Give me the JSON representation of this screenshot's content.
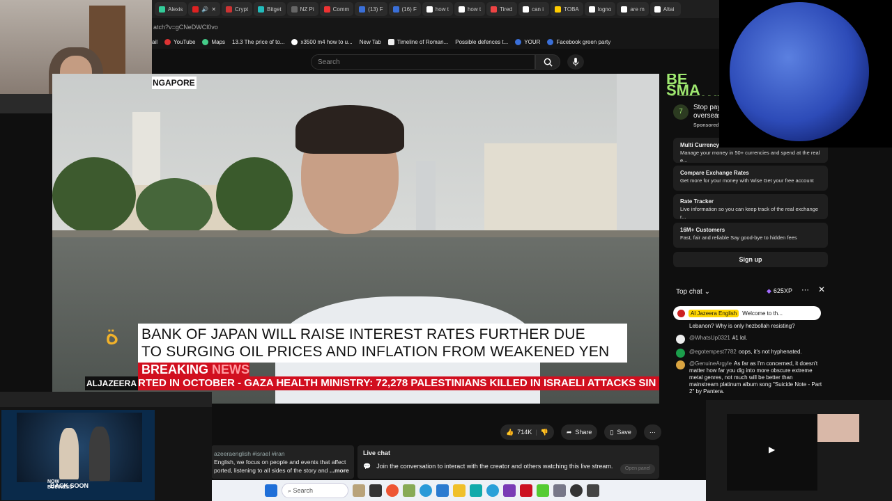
{
  "browser": {
    "tabs": [
      "Alexis",
      "Crypt",
      "Bitget",
      "NZ Pi",
      "Comm",
      "(13) F",
      "(16) F",
      "how t",
      "how t",
      "Tired",
      "can i",
      "TOBA",
      "logno",
      "are m",
      "Altai"
    ],
    "url": "atch?v=gCNeDWCl0vo",
    "bookmarks": [
      "ail",
      "YouTube",
      "Maps",
      "13.3 The price of to...",
      "x3500 m4 how to u...",
      "New Tab",
      "Timeline of Roman...",
      "Possible defences t...",
      "YOUR",
      "Facebook green party"
    ]
  },
  "youtube": {
    "search_placeholder": "Search"
  },
  "video": {
    "location": "NGAPORE",
    "headline_line1": "BANK OF JAPAN WILL RAISE INTEREST RATES FURTHER DUE",
    "headline_line2": "TO SURGING OIL PRICES AND INFLATION FROM WEAKENED YEN",
    "breaking_a": "BREAKING ",
    "breaking_b": "NEWS",
    "ticker": "RTED IN OCTOBER   -   GAZA HEALTH MINISTRY: 72,278 PALESTINIANS KILLED IN ISRAELI ATTACKS SIN",
    "channel_logo": "ALJAZEERA"
  },
  "actions": {
    "likes": "714K",
    "share": "Share",
    "save": "Save"
  },
  "description": {
    "tags": "azeeraenglish #israel #iran",
    "text1": "English,  we focus on people and events that affect",
    "text2": "ported, listening to all sides of the story and",
    "more": "...more"
  },
  "live_chat_box": {
    "title": "Live chat",
    "text": "Join the conversation to interact with the creator and others watching this live stream.",
    "open_panel": "Open panel"
  },
  "ad": {
    "headline": "BE SMA GET WI",
    "stop_title": "Stop pay overseas",
    "sponsored": "Sponsored",
    "rows": [
      {
        "title": "Multi Currency Ac",
        "text": "Manage your money in 50+ currencies and spend at the real e..."
      },
      {
        "title": "Compare Exchange Rates",
        "text": "Get more for your money with Wise Get your free account"
      },
      {
        "title": "Rate Tracker",
        "text": "Live information so you can keep track of the real exchange r..."
      },
      {
        "title": "16M+ Customers",
        "text": "Fast, fair and reliable Say good-bye to hidden fees"
      }
    ],
    "signup": "Sign up"
  },
  "chat": {
    "title": "Top chat",
    "xp": "625XP",
    "pinned_author": "Al Jazeera English",
    "pinned_text": "Welcome to th...",
    "messages": [
      {
        "author": "",
        "text": "Lebanon? Why is only hezbollah resisting?",
        "color": "#555"
      },
      {
        "author": "@WhatsUp0321",
        "text": "#1   lol.",
        "color": "#eee"
      },
      {
        "author": "@egotempest7782",
        "text": "oops, it's not hyphenated.",
        "color": "#1b9e4b"
      },
      {
        "author": "@GenuineArgyle",
        "text": "As far as I'm concerned, it doesn't matter how far you dig into more obscure extreme metal genres, not much will be better than mainstream platinum album song \"Suicide Note - Part 2\" by Pantera.",
        "color": "#d9a441"
      }
    ]
  },
  "overlay": {
    "mini_caption": "BACK SOON",
    "mini_brand": "NOW BUSINESS"
  },
  "taskbar": {
    "search": "Search"
  },
  "colors": {
    "breaking_red": "#d10f1f",
    "wise_green": "#9fe870",
    "planet_blue": "#2d4bb8"
  }
}
